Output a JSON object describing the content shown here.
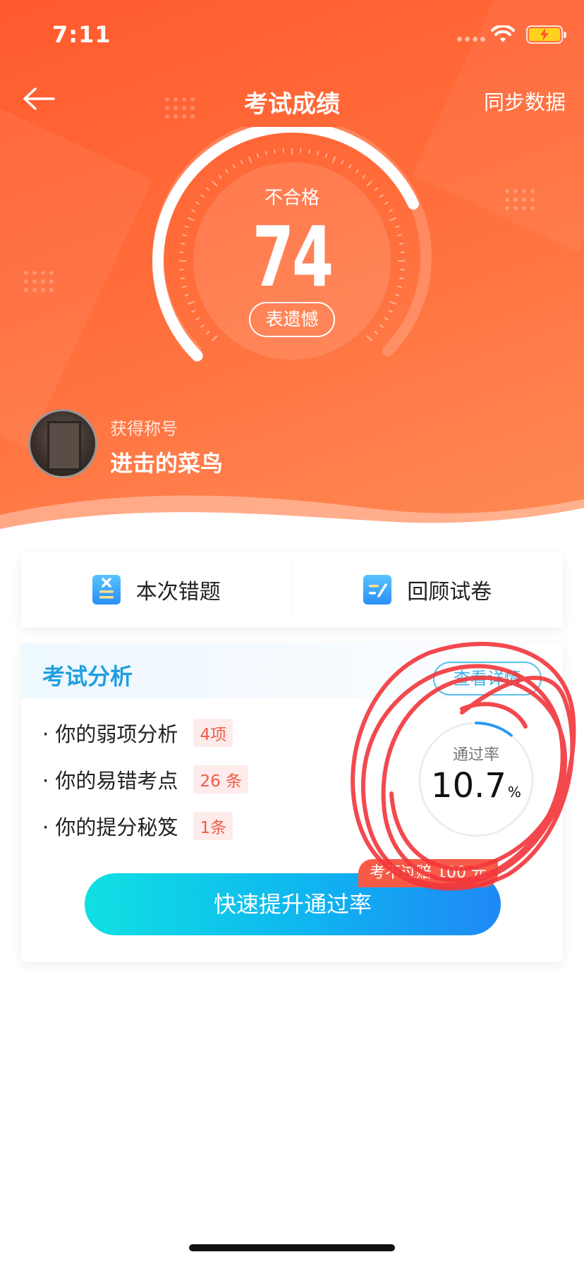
{
  "status_bar": {
    "time": "7:11"
  },
  "nav": {
    "title": "考试成绩",
    "sync_label": "同步数据"
  },
  "score": {
    "result_label": "不合格",
    "value": "74",
    "action_label": "表遗憾",
    "progress_fraction": 0.74
  },
  "profile": {
    "title_label": "获得称号",
    "title_value": "进击的菜鸟"
  },
  "quick_links": {
    "wrong_questions": "本次错题",
    "review_paper": "回顾试卷"
  },
  "analysis": {
    "heading": "考试分析",
    "detail_button": "查看详情",
    "items": [
      {
        "label": "· 你的弱项分析",
        "tag": "4项"
      },
      {
        "label": "· 你的易错考点",
        "tag": "26 条"
      },
      {
        "label": "· 你的提分秘笈",
        "tag": "1条"
      }
    ],
    "pass_rate_label": "通过率",
    "pass_rate_value": "10.7",
    "pass_rate_unit": "%",
    "cta_label": "快速提升通过率",
    "cta_badge": "考不过赔 100 元"
  },
  "colors": {
    "hero": "#ff6a36",
    "accent_blue": "#1f9fe0",
    "warning_red": "#f05a4a",
    "annotation": "#f2363b"
  }
}
